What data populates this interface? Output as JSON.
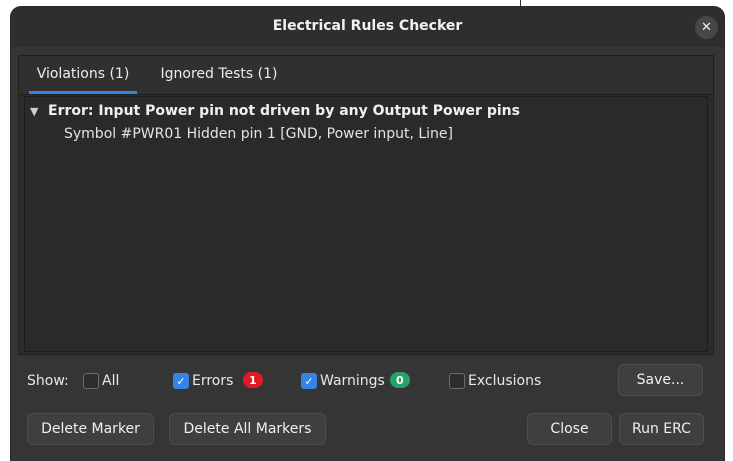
{
  "window": {
    "title": "Electrical Rules Checker"
  },
  "tabs": [
    {
      "label": "Violations (1)",
      "active": true
    },
    {
      "label": "Ignored Tests (1)",
      "active": false
    }
  ],
  "violations": [
    {
      "title": "Error: Input Power pin not driven by any Output Power pins",
      "detail": "Symbol #PWR01 Hidden pin 1 [GND, Power input, Line]",
      "expanded": true
    }
  ],
  "filters": {
    "show_label": "Show:",
    "all": {
      "label": "All",
      "checked": false
    },
    "errors": {
      "label": "Errors",
      "checked": true,
      "count": "1",
      "color": "#e01b24"
    },
    "warnings": {
      "label": "Warnings",
      "checked": true,
      "count": "0",
      "color": "#26a269"
    },
    "exclusions": {
      "label": "Exclusions",
      "checked": false
    }
  },
  "buttons": {
    "save": "Save...",
    "delete_marker": "Delete Marker",
    "delete_all_markers": "Delete All Markers",
    "close": "Close",
    "run_erc": "Run ERC"
  },
  "colors": {
    "accent": "#3584e4"
  }
}
